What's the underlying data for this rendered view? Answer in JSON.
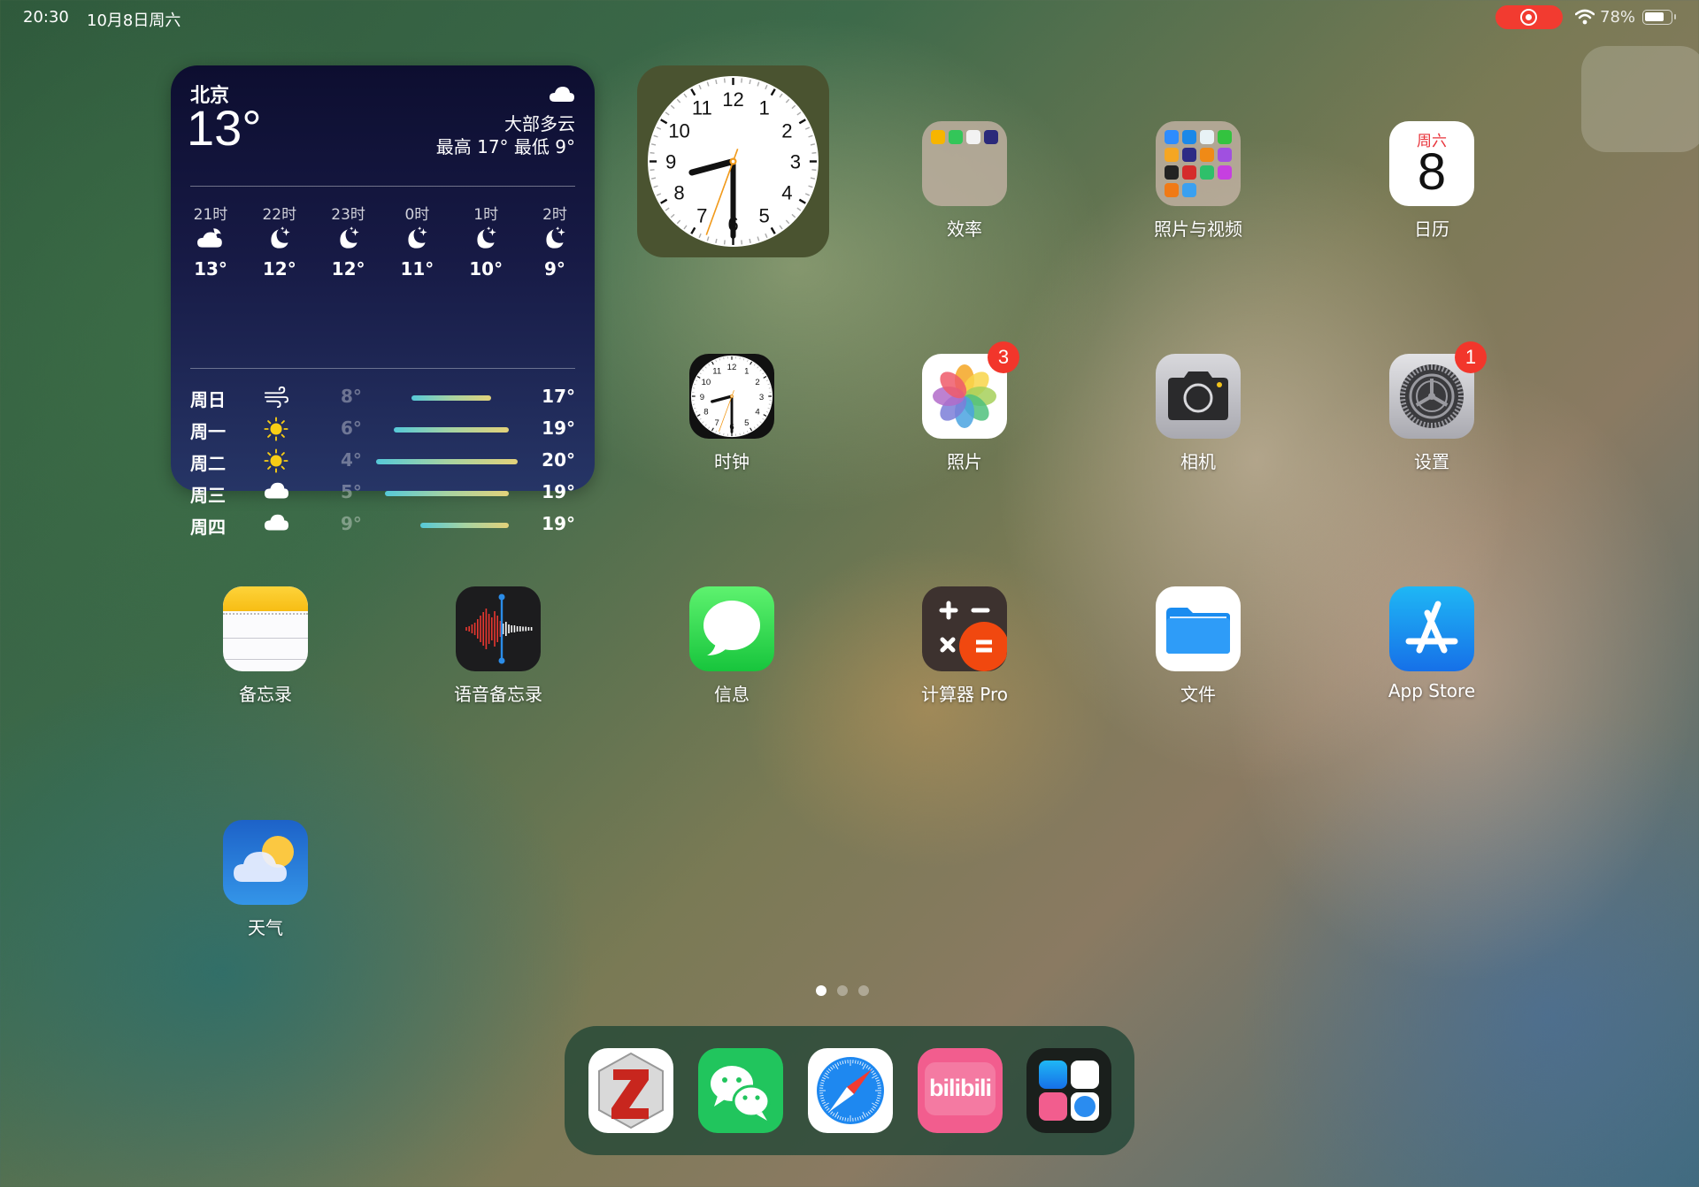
{
  "status_bar": {
    "time": "20:30",
    "date": "10月8日周六",
    "battery_percent": "78%",
    "battery_level": 0.78,
    "screen_recording": true
  },
  "weather_widget": {
    "city": "北京",
    "current_temp": "13°",
    "condition": "大部多云",
    "high_low": "最高 17° 最低 9°",
    "condition_icon": "cloud-icon",
    "hourly": [
      {
        "time": "21时",
        "icon": "cloud-moon-icon",
        "temp": "13°"
      },
      {
        "time": "22时",
        "icon": "moon-stars-icon",
        "temp": "12°"
      },
      {
        "time": "23时",
        "icon": "moon-stars-icon",
        "temp": "12°"
      },
      {
        "time": "0时",
        "icon": "moon-stars-icon",
        "temp": "11°"
      },
      {
        "time": "1时",
        "icon": "moon-stars-icon",
        "temp": "10°"
      },
      {
        "time": "2时",
        "icon": "moon-stars-icon",
        "temp": "9°"
      }
    ],
    "daily_range": {
      "min": 4,
      "max": 20
    },
    "daily": [
      {
        "day": "周日",
        "icon": "wind-icon",
        "low": "8°",
        "high": "17°",
        "low_val": 8,
        "high_val": 17
      },
      {
        "day": "周一",
        "icon": "sun-icon",
        "low": "6°",
        "high": "19°",
        "low_val": 6,
        "high_val": 19
      },
      {
        "day": "周二",
        "icon": "sun-icon",
        "low": "4°",
        "high": "20°",
        "low_val": 4,
        "high_val": 20
      },
      {
        "day": "周三",
        "icon": "cloud-icon",
        "low": "5°",
        "high": "19°",
        "low_val": 5,
        "high_val": 19
      },
      {
        "day": "周四",
        "icon": "cloud-icon",
        "low": "9°",
        "high": "19°",
        "low_val": 9,
        "high_val": 19
      }
    ]
  },
  "clock_widget": {
    "time_shown": "20:30",
    "numerals": [
      "12",
      "1",
      "2",
      "3",
      "4",
      "5",
      "6",
      "7",
      "8",
      "9",
      "10",
      "11"
    ]
  },
  "apps": {
    "productivity_folder": {
      "label": "效率"
    },
    "photo_video_folder": {
      "label": "照片与视频"
    },
    "calendar": {
      "label": "日历",
      "weekday": "周六",
      "day": "8"
    },
    "clock": {
      "label": "时钟"
    },
    "photos": {
      "label": "照片",
      "badge": "3"
    },
    "camera": {
      "label": "相机"
    },
    "settings": {
      "label": "设置",
      "badge": "1"
    },
    "notes": {
      "label": "备忘录"
    },
    "voice_memos": {
      "label": "语音备忘录"
    },
    "messages": {
      "label": "信息"
    },
    "calculator_pro": {
      "label": "计算器 Pro"
    },
    "files": {
      "label": "文件"
    },
    "app_store": {
      "label": "App Store"
    },
    "weather": {
      "label": "天气"
    }
  },
  "page_indicator": {
    "total": 3,
    "current": 1
  },
  "dock": {
    "apps": [
      {
        "name": "Zotero",
        "icon": "zotero-icon"
      },
      {
        "name": "WeChat",
        "icon": "wechat-icon"
      },
      {
        "name": "Safari",
        "icon": "safari-icon"
      },
      {
        "name": "bilibili",
        "icon": "bilibili-icon",
        "text": "bilibili"
      },
      {
        "name": "Recent Apps",
        "icon": "recent-apps-icon"
      }
    ]
  }
}
